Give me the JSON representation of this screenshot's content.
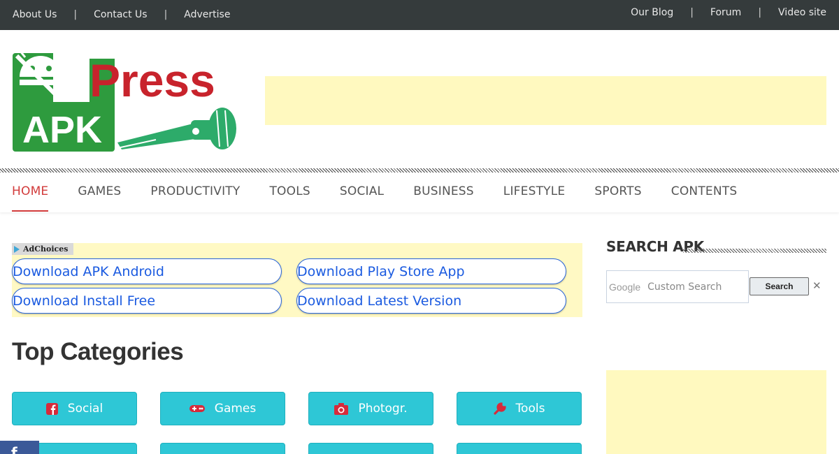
{
  "topbar": {
    "left_links": [
      "About Us",
      "Contact Us",
      "Advertise"
    ],
    "right_links": [
      "Our Blog",
      "Forum",
      "Video site"
    ],
    "separator": "|"
  },
  "logo": {
    "word_top": "Press",
    "word_bottom": "APK"
  },
  "nav": {
    "items": [
      "HOME",
      "GAMES",
      "PRODUCTIVITY",
      "TOOLS",
      "SOCIAL",
      "BUSINESS",
      "LIFESTYLE",
      "SPORTS",
      "CONTENTS"
    ],
    "active_index": 0
  },
  "ad_links": {
    "adchoices_label": "AdChoices",
    "links": [
      "Download APK Android",
      "Download Play Store App",
      "Download Install Free",
      "Download Latest Version"
    ]
  },
  "main": {
    "top_categories_title": "Top Categories",
    "categories": [
      {
        "label": "Social",
        "icon": "facebook-square-icon"
      },
      {
        "label": "Games",
        "icon": "gamepad-icon"
      },
      {
        "label": "Photogr.",
        "icon": "camera-icon"
      },
      {
        "label": "Tools",
        "icon": "wrench-icon"
      }
    ]
  },
  "sidebar": {
    "search_title": "SEARCH APK",
    "google_label": "Google",
    "search_placeholder": "Custom Search",
    "search_button": "Search",
    "clear_symbol": "✕"
  },
  "floating": {
    "facebook_label": "f"
  },
  "colors": {
    "topbar_bg": "#353b3c",
    "accent_red": "#d23b3b",
    "category_teal": "#2ec7d6",
    "ad_yellow": "#fff9bf",
    "logo_green": "#2e9b3e",
    "logo_red": "#c8232c",
    "link_blue": "#1a5ae0"
  }
}
